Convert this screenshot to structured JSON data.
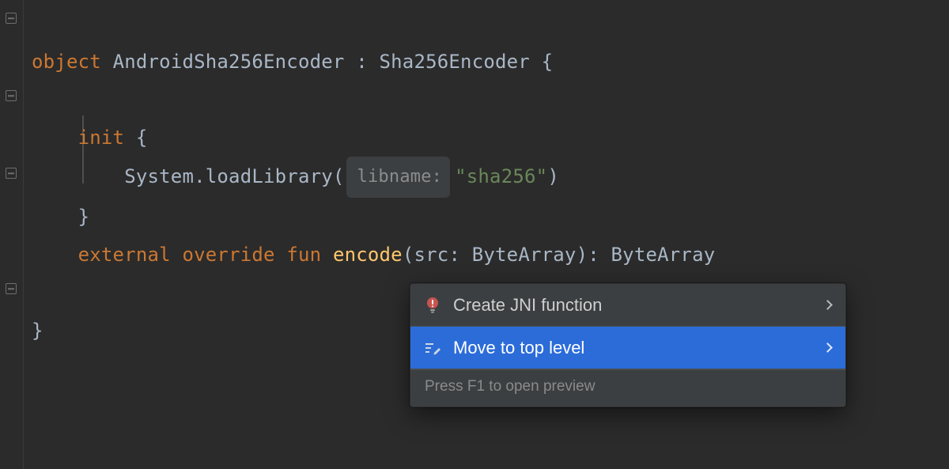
{
  "code": {
    "line1": {
      "kw_object": "object",
      "class_name": "AndroidSha256Encoder",
      "colon": " : ",
      "super_name": "Sha256Encoder",
      "brace_open": " {"
    },
    "line2": "",
    "line3": {
      "kw_init": "init",
      "brace_open": " {"
    },
    "line4": {
      "call_prefix": "System.loadLibrary(",
      "hint_label": "libname:",
      "str_value": "\"sha256\"",
      "call_suffix": ")"
    },
    "line5": {
      "brace_close": "}"
    },
    "line6": {
      "kw_external": "external",
      "kw_override": "override",
      "kw_fun": "fun",
      "func_name": "encode",
      "sig_open": "(src: ByteArray): ByteArray"
    },
    "line8": {
      "brace_close": "}"
    }
  },
  "popup": {
    "items": [
      {
        "label": "Create JNI function",
        "selected": false,
        "icon": "bulb-error"
      },
      {
        "label": "Move to top level",
        "selected": true,
        "icon": "edit"
      }
    ],
    "footer": "Press F1 to open preview"
  }
}
